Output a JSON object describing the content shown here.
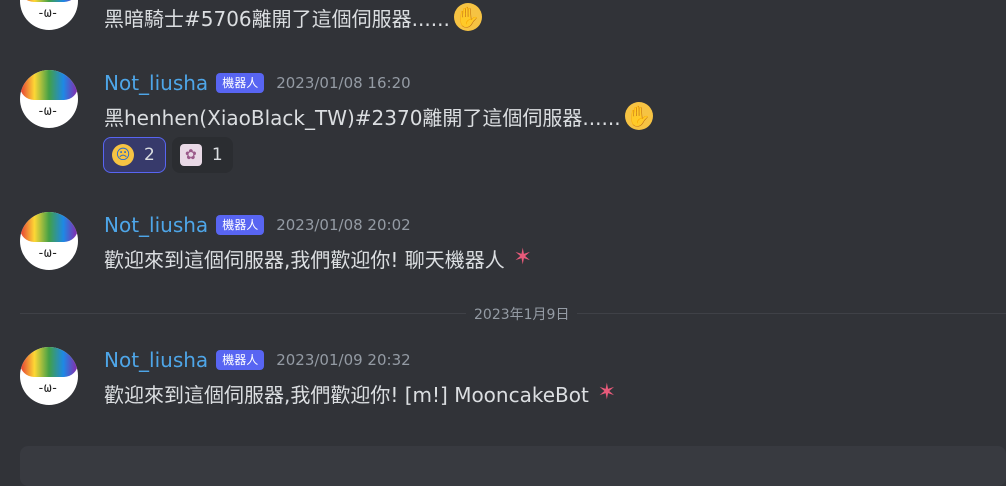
{
  "messages": [
    {
      "content": "黑暗騎士#5706離開了這個伺服器......",
      "emoji": "wave"
    },
    {
      "username": "Not_liusha",
      "bot_tag": "機器人",
      "timestamp": "2023/01/08 16:20",
      "content": "黑henhen(XiaoBlack_TW)#2370離開了這個伺服器......",
      "emoji": "wave",
      "reactions": [
        {
          "emoji": "sad-tear",
          "count": "2",
          "active": true
        },
        {
          "emoji": "anime-sticker",
          "count": "1",
          "active": false
        }
      ]
    },
    {
      "username": "Not_liusha",
      "bot_tag": "機器人",
      "timestamp": "2023/01/08 20:02",
      "content": "歡迎來到這個伺服器,我們歡迎你! 聊天機器人",
      "emoji": "party-popper"
    },
    {
      "username": "Not_liusha",
      "bot_tag": "機器人",
      "timestamp": "2023/01/09 20:32",
      "content": "歡迎來到這個伺服器,我們歡迎你! [m!] MooncakeBot",
      "emoji": "party-popper"
    }
  ],
  "date_divider": "2023年1月9日",
  "colors": {
    "background": "#313338",
    "username": "#4ea6e8",
    "bot_tag_bg": "#5865f2",
    "timestamp": "#949ba4",
    "text": "#dbdee1"
  }
}
